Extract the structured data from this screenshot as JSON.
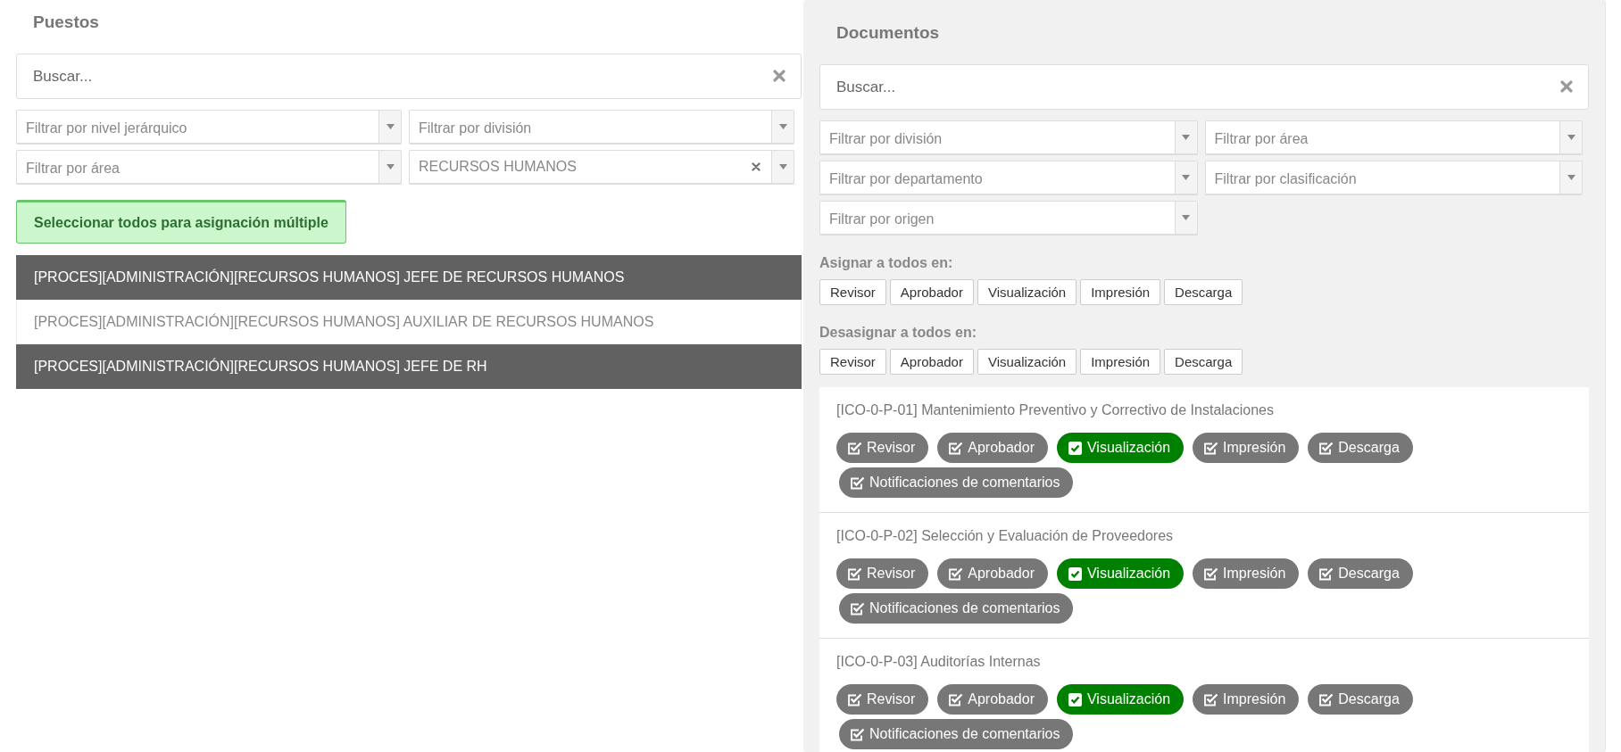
{
  "puestos": {
    "title": "Puestos",
    "search": {
      "placeholder": "Buscar..."
    },
    "filters": [
      {
        "placeholder": "Filtrar por nivel jerárquico"
      },
      {
        "placeholder": "Filtrar por división"
      },
      {
        "placeholder": "Filtrar por área"
      },
      {
        "value": "RECURSOS HUMANOS"
      }
    ],
    "select_all_button": "Seleccionar todos para asignación múltiple",
    "items": [
      {
        "label": "[PROCES][ADMINISTRACIÓN][RECURSOS HUMANOS] JEFE DE RECURSOS HUMANOS",
        "selected": true
      },
      {
        "label": "[PROCES][ADMINISTRACIÓN][RECURSOS HUMANOS] AUXILIAR DE RECURSOS HUMANOS",
        "selected": false
      },
      {
        "label": "[PROCES][ADMINISTRACIÓN][RECURSOS HUMANOS] JEFE DE RH",
        "selected": true
      }
    ]
  },
  "documentos": {
    "title": "Documentos",
    "search": {
      "placeholder": "Buscar..."
    },
    "filters": [
      {
        "placeholder": "Filtrar por división"
      },
      {
        "placeholder": "Filtrar por área"
      },
      {
        "placeholder": "Filtrar por departamento"
      },
      {
        "placeholder": "Filtrar por clasificación"
      },
      {
        "placeholder": "Filtrar por origen"
      }
    ],
    "assign": {
      "label": "Asignar a todos en:",
      "buttons": [
        "Revisor",
        "Aprobador",
        "Visualización",
        "Impresión",
        "Descarga"
      ]
    },
    "unassign": {
      "label": "Desasignar a todos en:",
      "buttons": [
        "Revisor",
        "Aprobador",
        "Visualización",
        "Impresión",
        "Descarga"
      ]
    },
    "documents": [
      {
        "title": "[ICO-0-P-01] Mantenimiento Preventivo y Correctivo de Instalaciones",
        "permissions": [
          {
            "label": "Revisor",
            "on": false
          },
          {
            "label": "Aprobador",
            "on": false
          },
          {
            "label": "Visualización",
            "on": true
          },
          {
            "label": "Impresión",
            "on": false
          },
          {
            "label": "Descarga",
            "on": false
          },
          {
            "label": "Notificaciones de comentarios",
            "on": false
          }
        ]
      },
      {
        "title": "[ICO-0-P-02] Selección y Evaluación de Proveedores",
        "permissions": [
          {
            "label": "Revisor",
            "on": false
          },
          {
            "label": "Aprobador",
            "on": false
          },
          {
            "label": "Visualización",
            "on": true
          },
          {
            "label": "Impresión",
            "on": false
          },
          {
            "label": "Descarga",
            "on": false
          },
          {
            "label": "Notificaciones de comentarios",
            "on": false
          }
        ]
      },
      {
        "title": "[ICO-0-P-03] Auditorías Internas",
        "permissions": [
          {
            "label": "Revisor",
            "on": false
          },
          {
            "label": "Aprobador",
            "on": false
          },
          {
            "label": "Visualización",
            "on": true
          },
          {
            "label": "Impresión",
            "on": false
          },
          {
            "label": "Descarga",
            "on": false
          },
          {
            "label": "Notificaciones de comentarios",
            "on": false
          }
        ]
      }
    ]
  }
}
